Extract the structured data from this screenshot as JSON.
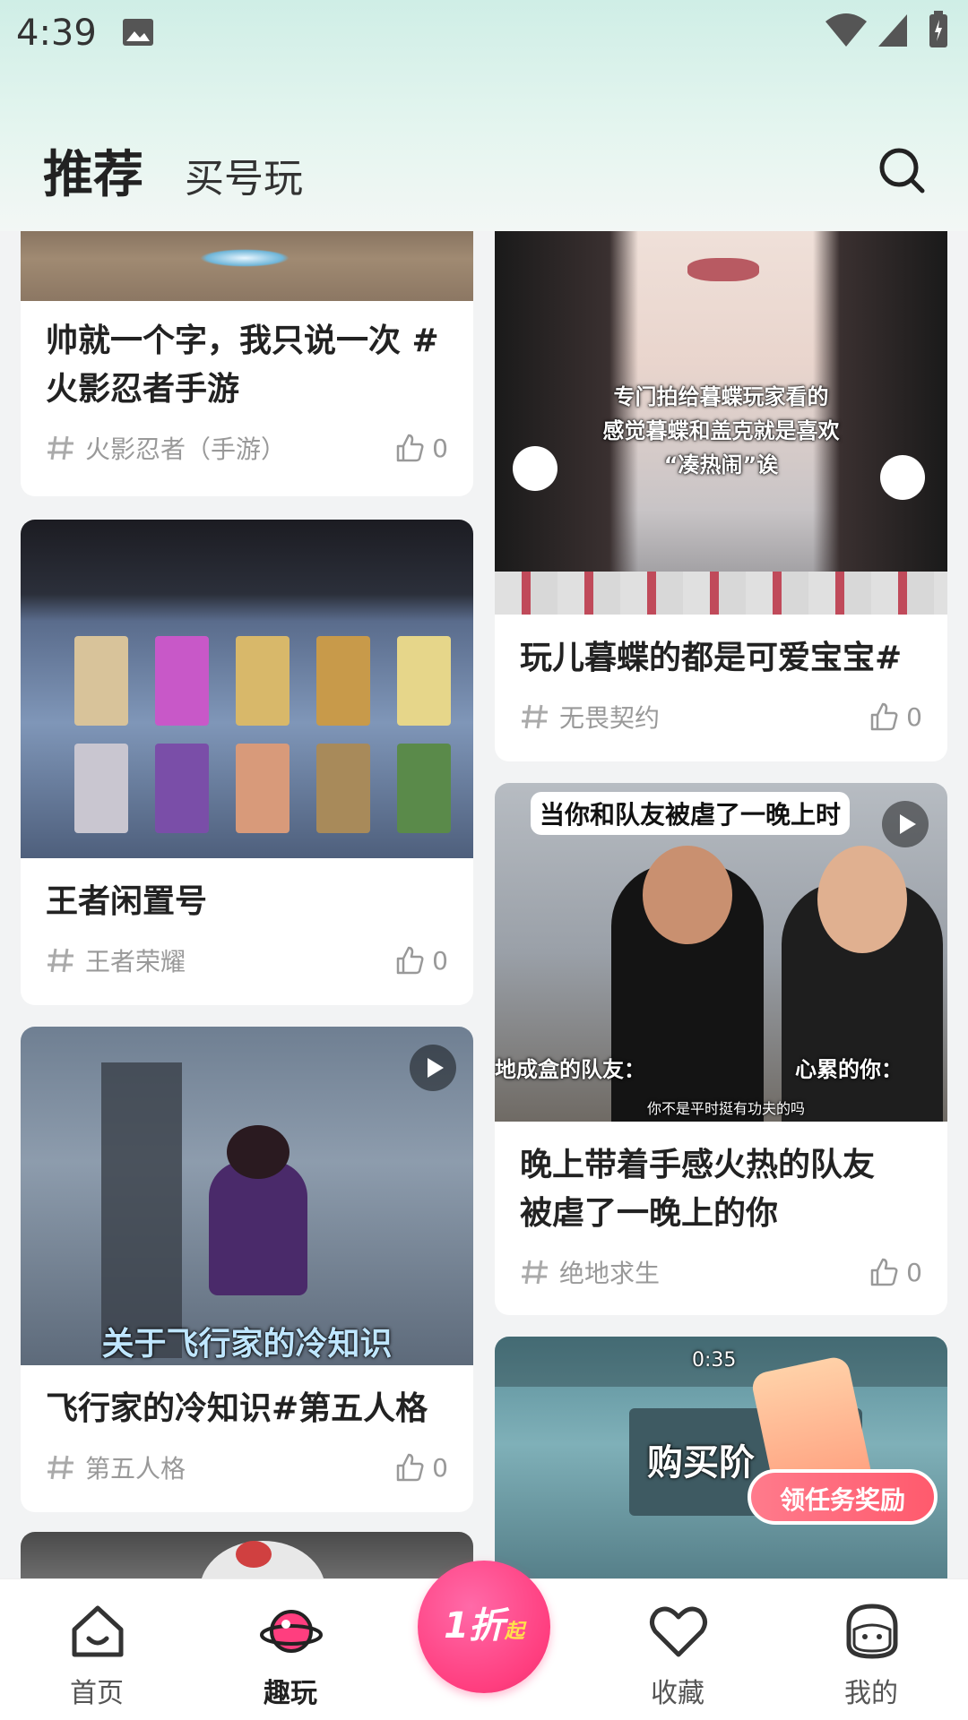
{
  "status_bar": {
    "time": "4:39"
  },
  "header": {
    "tabs": [
      {
        "label": "推荐"
      },
      {
        "label": "买号玩"
      }
    ]
  },
  "feed": {
    "left": [
      {
        "title_line1": "帅就一个字，我只说一次 #",
        "title_line2": "火影忍者手游",
        "tag": "火影忍者（手游）",
        "likes": "0"
      },
      {
        "title": "王者闲置号",
        "tag": "王者荣耀",
        "likes": "0"
      },
      {
        "title": "飞行家的冷知识#第五人格",
        "tag": "第五人格",
        "likes": "0",
        "overlay": "关于飞行家的冷知识"
      }
    ],
    "right": [
      {
        "title": "玩儿暮蝶的都是可爱宝宝#",
        "tag": "无畏契约",
        "likes": "0",
        "overlay_line1": "专门拍给暮蝶玩家看的",
        "overlay_line2": "感觉暮蝶和盖克就是喜欢",
        "overlay_line3": "“凑热闹”诶"
      },
      {
        "title_line1": "晚上带着手感火热的队友",
        "title_line2": "被虐了一晚上的你",
        "tag": "绝地求生",
        "likes": "0",
        "overlay_top": "当你和队友被虐了一晚上时",
        "overlay_left": "地成盒的队友：",
        "overlay_right": "心累的你：",
        "overlay_sub": "你不是平时挺有功夫的吗"
      },
      {
        "overlay_timer": "0:35",
        "overlay_text": "购买阶"
      }
    ]
  },
  "promo": {
    "cta": "领任务奖励"
  },
  "bottom_nav": {
    "items": [
      {
        "label": "首页"
      },
      {
        "label": "趣玩"
      },
      {
        "label": "收藏"
      },
      {
        "label": "我的"
      }
    ],
    "center_badge": "1折",
    "center_sup": "起"
  },
  "colors": {
    "accent": "#ff3e7f",
    "header_bg": "#d8f2ea"
  }
}
